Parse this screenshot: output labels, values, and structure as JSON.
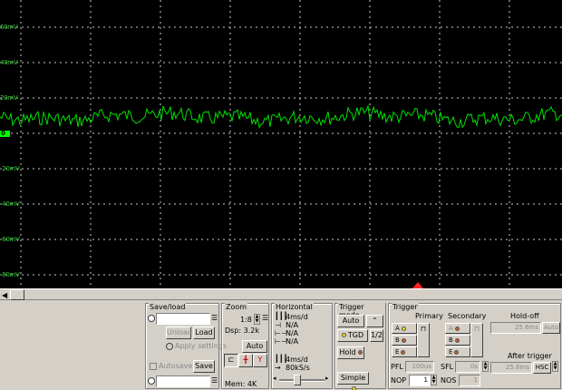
{
  "scope": {
    "y_labels": [
      "60mV",
      "40mV",
      "20mV",
      "0",
      "-20mV",
      "-40mV",
      "-60mV",
      "-80mV"
    ],
    "colors": {
      "trace": "#00e000",
      "grid": "#c8c8c8",
      "background": "#000000",
      "trigger_marker": "#ff2020"
    }
  },
  "saveload": {
    "title": "Save/load",
    "unload": "Unload",
    "load": "Load",
    "apply_settings": "Apply settings",
    "autosave": "Autosave",
    "save": "Save",
    "load_path": "",
    "save_path": ""
  },
  "zoom": {
    "title": "Zoom",
    "value": "1:8",
    "dsp": "Dsp: 3.2k",
    "auto": "Auto",
    "mem": "Mem: 4K"
  },
  "horizontal": {
    "title": "Horizontal",
    "time_div": "4ms/d",
    "na1": "N/A",
    "na2": "N/A",
    "na3": "N/A",
    "time_div2": "4ms/d",
    "sample_rate": "80kS/s"
  },
  "trigger_mode": {
    "title": "Trigger mode",
    "auto": "Auto",
    "tgd": "TGD",
    "half": "1/2",
    "hold": "Hold",
    "simple": "Simple"
  },
  "trigger": {
    "title": "Trigger",
    "primary": "Primary",
    "secondary": "Secondary",
    "holdoff": "Hold-off",
    "holdoff_value": "25.6ms",
    "holdoff_auto": "Auto",
    "after_trigger": "After trigger",
    "after_value": "25.6ms",
    "hsc": "HSC",
    "pfl_label": "PFL",
    "pfl_value": "100us",
    "sfl_label": "SFL",
    "sfl_value": "0s",
    "nop_label": "NOP",
    "nop_value": "1",
    "nos_label": "NOS",
    "nos_value": "1",
    "channels": [
      "A",
      "B",
      "E"
    ]
  }
}
